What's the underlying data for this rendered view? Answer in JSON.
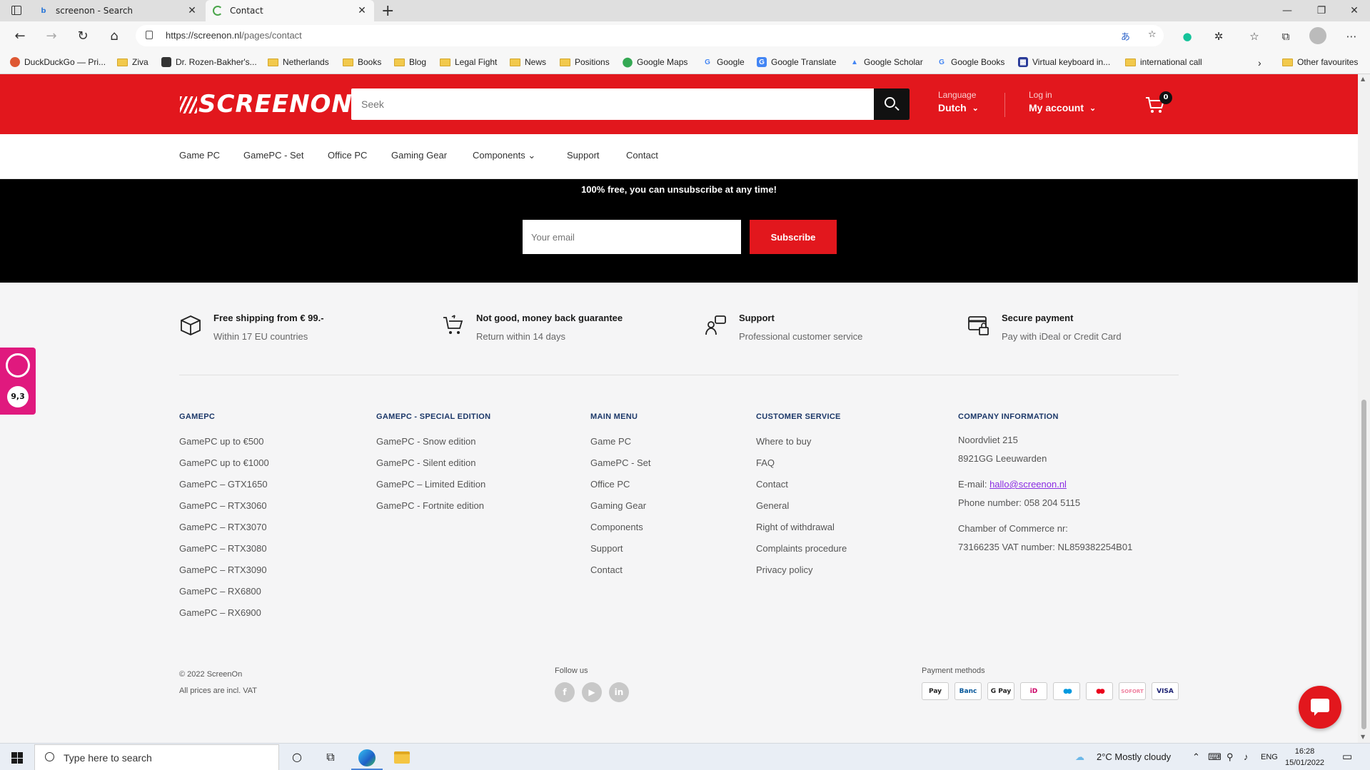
{
  "browser": {
    "tabs": [
      {
        "title": "screenon - Search"
      },
      {
        "title": "Contact"
      }
    ],
    "url_host": "https://screenon.nl",
    "url_path": "/pages/contact",
    "favorites": [
      {
        "label": "DuckDuckGo — Pri..."
      },
      {
        "label": "Ziva"
      },
      {
        "label": "Dr. Rozen-Bakher's..."
      },
      {
        "label": "Netherlands"
      },
      {
        "label": "Books"
      },
      {
        "label": "Blog"
      },
      {
        "label": "Legal Fight"
      },
      {
        "label": "News"
      },
      {
        "label": "Positions"
      },
      {
        "label": "Google Maps"
      },
      {
        "label": "Google"
      },
      {
        "label": "Google Translate"
      },
      {
        "label": "Google Scholar"
      },
      {
        "label": "Google Books"
      },
      {
        "label": "Virtual keyboard in..."
      },
      {
        "label": "international call"
      }
    ],
    "other_favourites": "Other favourites"
  },
  "header": {
    "logo": "SCREENON",
    "search_placeholder": "Seek",
    "language_label": "Language",
    "language_value": "Dutch",
    "login_label": "Log in",
    "account_label": "My account",
    "cart_count": "0"
  },
  "nav": {
    "items": [
      "Game PC",
      "GamePC - Set",
      "Office PC",
      "Gaming Gear",
      "Components",
      "Support",
      "Contact"
    ]
  },
  "newsletter": {
    "text": "100% free, you can unsubscribe at any time!",
    "email_placeholder": "Your email",
    "button": "Subscribe"
  },
  "features": [
    {
      "title": "Free shipping from € 99.-",
      "sub": "Within 17 EU countries",
      "icon": "box-icon"
    },
    {
      "title": "Not good, money back guarantee",
      "sub": "Return within 14 days",
      "icon": "cart-return-icon"
    },
    {
      "title": "Support",
      "sub": "Professional customer service",
      "icon": "support-icon"
    },
    {
      "title": "Secure payment",
      "sub": "Pay with iDeal or Credit Card",
      "icon": "secure-payment-icon"
    }
  ],
  "footer": {
    "gamepc": {
      "heading": "GAMEPC",
      "links": [
        "GamePC up to €500",
        "GamePC up to €1000",
        "GamePC – GTX1650",
        "GamePC – RTX3060",
        "GamePC – RTX3070",
        "GamePC – RTX3080",
        "GamePC – RTX3090",
        "GamePC – RX6800",
        "GamePC – RX6900"
      ]
    },
    "special": {
      "heading": "GAMEPC - SPECIAL EDITION",
      "links": [
        "GamePC - Snow edition",
        "GamePC - Silent edition",
        "GamePC – Limited Edition",
        "GamePC - Fortnite edition"
      ]
    },
    "main_menu": {
      "heading": "MAIN MENU",
      "links": [
        "Game PC",
        "GamePC - Set",
        "Office PC",
        "Gaming Gear",
        "Components",
        "Support",
        "Contact"
      ]
    },
    "customer_service": {
      "heading": "CUSTOMER SERVICE",
      "links": [
        "Where to buy",
        "FAQ",
        "Contact",
        "General",
        "Right of withdrawal",
        "Complaints procedure",
        "Privacy policy"
      ]
    },
    "company": {
      "heading": "COMPANY INFORMATION",
      "address1": "Noordvliet 215",
      "address2": "8921GG Leeuwarden",
      "email_label": "E-mail:",
      "email": "hallo@screenon.nl",
      "phone": "Phone number: 058 204 5115",
      "coc_label": "Chamber of Commerce nr:",
      "coc_vat": "73166235 VAT number: NL859382254B01"
    },
    "copyright": "© 2022 ScreenOn",
    "prices_note": "All prices are incl. VAT",
    "follow_label": "Follow us",
    "social": [
      "f",
      "▶",
      "in"
    ],
    "payment_label": "Payment methods",
    "payment_methods": [
      "Pay",
      "Banc",
      "G Pay",
      "iD",
      "●●",
      "●●",
      "SOFORT",
      "VISA"
    ]
  },
  "rating": {
    "score": "9,3"
  },
  "taskbar": {
    "search_placeholder": "Type here to search",
    "weather": "2°C  Mostly cloudy",
    "lang": "ENG",
    "time": "16:28",
    "date": "15/01/2022"
  }
}
